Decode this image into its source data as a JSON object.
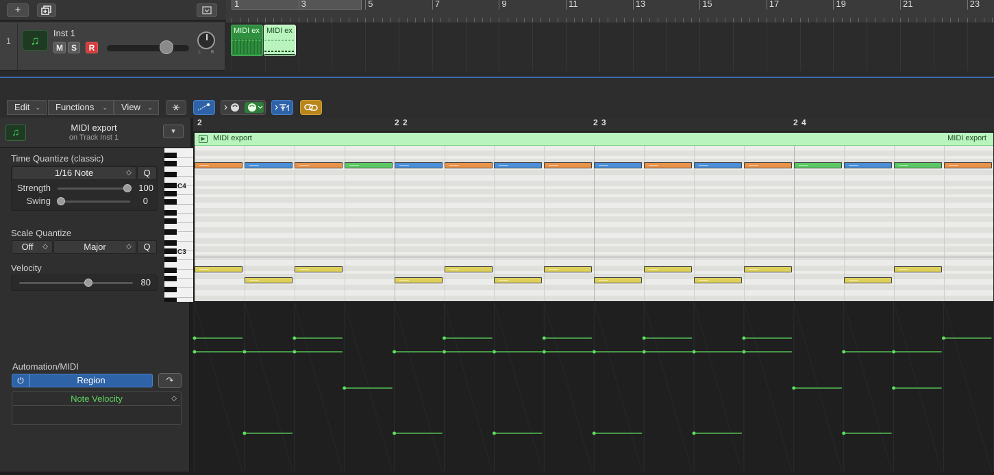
{
  "top_toolbar": {
    "add_track_icon": "plus-icon",
    "duplicate_track_icon": "duplicate-icon",
    "collapse_icon": "collapse-icon"
  },
  "track": {
    "number": "1",
    "name": "Inst 1",
    "icon": "music-note-icon",
    "mute": "M",
    "solo": "S",
    "record": "R",
    "pan_left": "L",
    "pan_right": "R"
  },
  "arrange_ruler": {
    "bars": [
      "1",
      "3",
      "5",
      "7",
      "9",
      "11",
      "13",
      "15",
      "17",
      "19",
      "21",
      "23"
    ]
  },
  "arrange_regions": [
    {
      "label": "MIDI ex",
      "selected": false
    },
    {
      "label": "MIDI ex",
      "selected": true
    }
  ],
  "piano_roll_toolbar": {
    "menus": [
      "Edit",
      "Functions",
      "View"
    ]
  },
  "inspector": {
    "region_title": "MIDI export",
    "region_subtitle": "on Track Inst 1",
    "time_quantize_label": "Time Quantize (classic)",
    "time_quantize_value": "1/16 Note",
    "q_button": "Q",
    "strength_label": "Strength",
    "strength_value": "100",
    "swing_label": "Swing",
    "swing_value": "0",
    "scale_quantize_label": "Scale Quantize",
    "scale_off": "Off",
    "scale_major": "Major",
    "velocity_label": "Velocity",
    "velocity_value": "80"
  },
  "keyboard": {
    "c4": "C4",
    "c3": "C3"
  },
  "piano_roll": {
    "ruler_bars": [
      "2",
      "2 2",
      "2 3",
      "2 4"
    ],
    "region_name": "MIDI export",
    "region_name_right": "MIDI export",
    "colors": {
      "orange": "#e8924a",
      "blue": "#4a8fd8",
      "green": "#5ac864",
      "yellow": "#dcd05a",
      "region_green": "#b9f4bf"
    },
    "upper_notes": [
      "orange",
      "blue",
      "orange",
      "green",
      "blue",
      "orange",
      "blue",
      "orange",
      "blue",
      "orange",
      "blue",
      "orange",
      "green",
      "blue",
      "green",
      "orange"
    ],
    "lower_notes": [
      {
        "step": 0,
        "row": "high"
      },
      {
        "step": 1,
        "row": "low"
      },
      {
        "step": 2,
        "row": "high"
      },
      {
        "step": 4,
        "row": "low"
      },
      {
        "step": 5,
        "row": "high"
      },
      {
        "step": 6,
        "row": "low"
      },
      {
        "step": 7,
        "row": "high"
      },
      {
        "step": 8,
        "row": "low"
      },
      {
        "step": 9,
        "row": "high"
      },
      {
        "step": 10,
        "row": "low"
      },
      {
        "step": 11,
        "row": "high"
      },
      {
        "step": 13,
        "row": "low"
      },
      {
        "step": 14,
        "row": "high"
      }
    ]
  },
  "automation": {
    "label": "Automation/MIDI",
    "power_icon": "power-icon",
    "mode": "Region",
    "arrow_icon": "curve-arrow-icon",
    "parameter": "Note Velocity",
    "line_color": "#5ee05e"
  }
}
